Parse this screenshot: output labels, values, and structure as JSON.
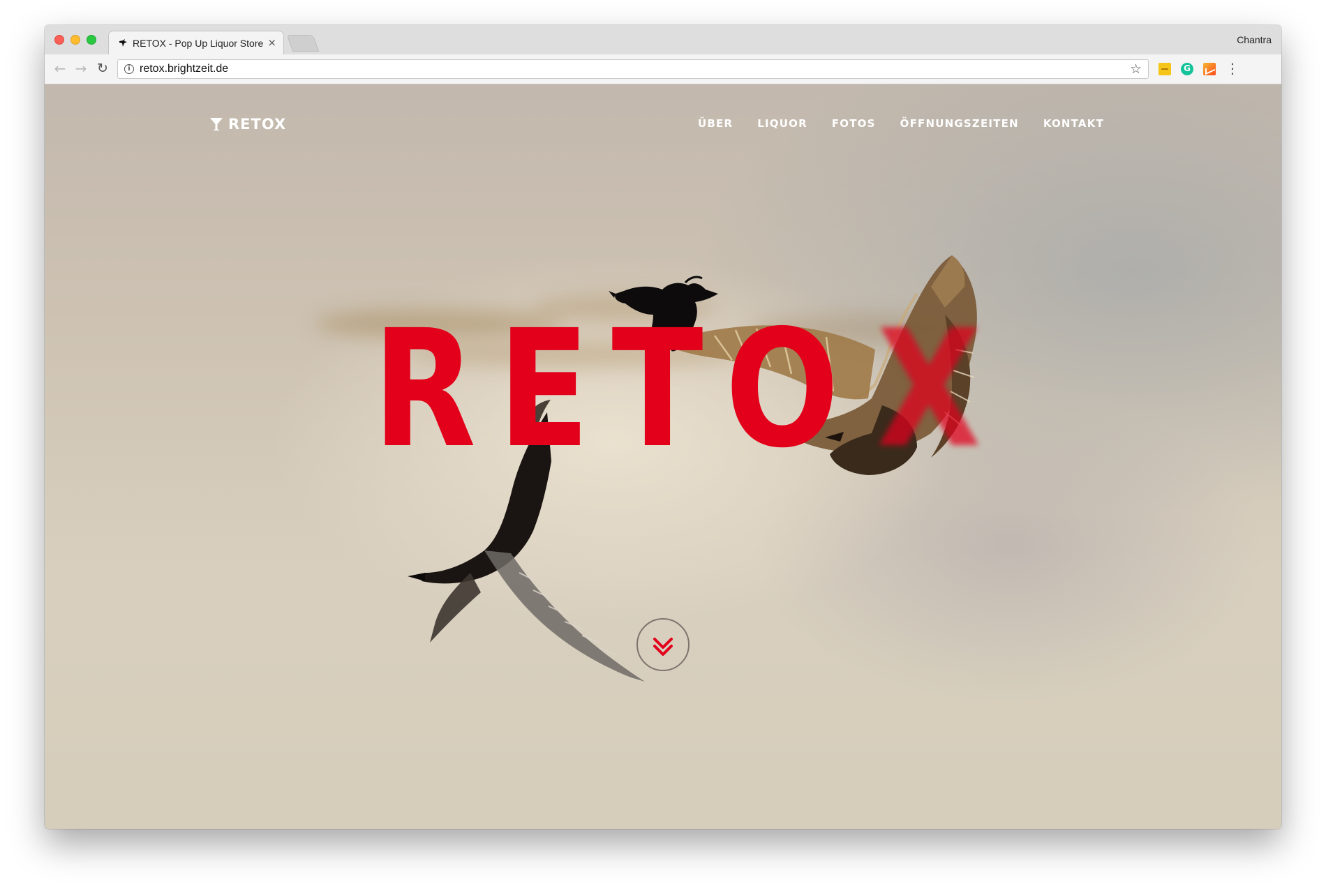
{
  "browser": {
    "tab": {
      "title": "RETOX - Pop Up Liquor Store",
      "close": "×"
    },
    "profile_name": "Chantra",
    "url": "retox.brightzeit.de",
    "icons": {
      "back": "back-arrow-icon",
      "forward": "forward-arrow-icon",
      "reload": "reload-icon",
      "info": "info-icon",
      "star": "star-icon",
      "menu": "menu-dots-icon"
    }
  },
  "site": {
    "logo_text": "RETOX",
    "nav": [
      {
        "label": "ÜBER"
      },
      {
        "label": "LIQUOR"
      },
      {
        "label": "FOTOS"
      },
      {
        "label": "ÖFFNUNGSZEITEN"
      },
      {
        "label": "KONTAKT"
      }
    ],
    "hero_title": "RETOX",
    "colors": {
      "brand_red": "#e2001a",
      "nav_text": "#ffffff"
    }
  }
}
